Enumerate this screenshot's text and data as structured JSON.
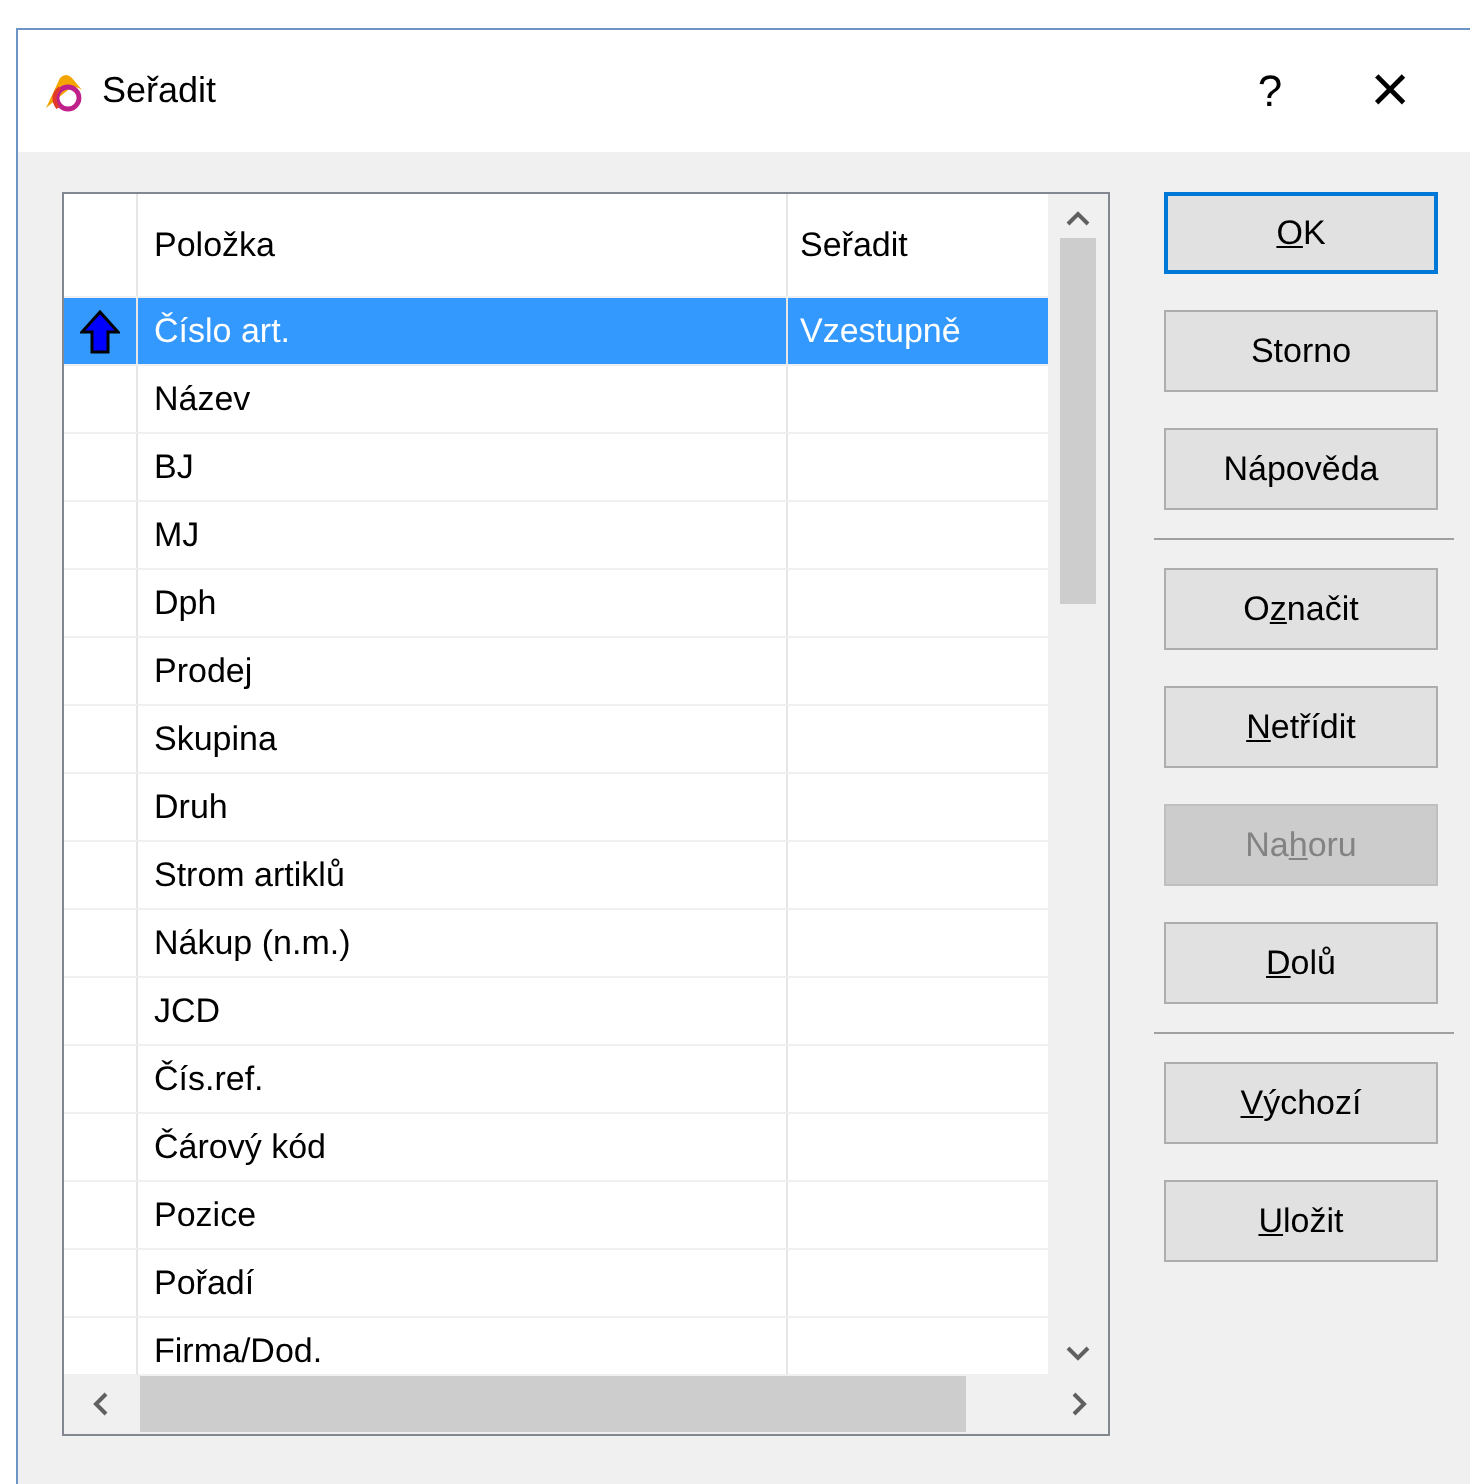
{
  "window": {
    "title": "Seřadit",
    "help": "?",
    "close": "×"
  },
  "table": {
    "columns": [
      "Položka",
      "Seřadit"
    ],
    "rows": [
      {
        "item": "Číslo art.",
        "order": "Vzestupně",
        "kind": "ascending",
        "selected": true
      },
      {
        "item": "Název",
        "kind": "plain",
        "selected": false
      },
      {
        "item": "BJ",
        "kind": "plain",
        "selected": false
      },
      {
        "item": "MJ",
        "kind": "plain",
        "selected": false
      },
      {
        "item": "Dph",
        "kind": "plain",
        "selected": false
      },
      {
        "item": "Prodej",
        "kind": "plain",
        "selected": false
      },
      {
        "item": "Skupina",
        "kind": "plain",
        "selected": false
      },
      {
        "item": "Druh",
        "kind": "plain",
        "selected": false
      },
      {
        "item": "Strom artiklů",
        "kind": "plain",
        "selected": false
      },
      {
        "item": "Nákup (n.m.)",
        "kind": "plain",
        "selected": false
      },
      {
        "item": "JCD",
        "kind": "plain",
        "selected": false
      },
      {
        "item": "Čís.ref.",
        "kind": "plain",
        "selected": false
      },
      {
        "item": "Čárový kód",
        "kind": "plain",
        "selected": false
      },
      {
        "item": "Pozice",
        "kind": "plain",
        "selected": false
      },
      {
        "item": "Pořadí",
        "kind": "plain",
        "selected": false
      },
      {
        "item": "Firma/Dod.",
        "kind": "plain",
        "selected": false
      }
    ]
  },
  "buttons": [
    {
      "key": "O",
      "post": "K",
      "default": true,
      "disabled": false
    },
    {
      "pre": "Storno",
      "default": false,
      "disabled": false
    },
    {
      "pre": "Nápověda",
      "default": false,
      "disabled": false,
      "separator_after": true
    },
    {
      "pre": "O",
      "key": "z",
      "post": "načit",
      "default": false,
      "disabled": false
    },
    {
      "key": "N",
      "post": "etřídit",
      "default": false,
      "disabled": false
    },
    {
      "pre": "Na",
      "key": "h",
      "post": "oru",
      "default": false,
      "disabled": true
    },
    {
      "key": "D",
      "post": "olů",
      "default": false,
      "disabled": false,
      "separator_after": true
    },
    {
      "key": "V",
      "post": "ýchozí",
      "default": false,
      "disabled": false
    },
    {
      "key": "U",
      "post": "ložit",
      "default": false,
      "disabled": false
    }
  ]
}
